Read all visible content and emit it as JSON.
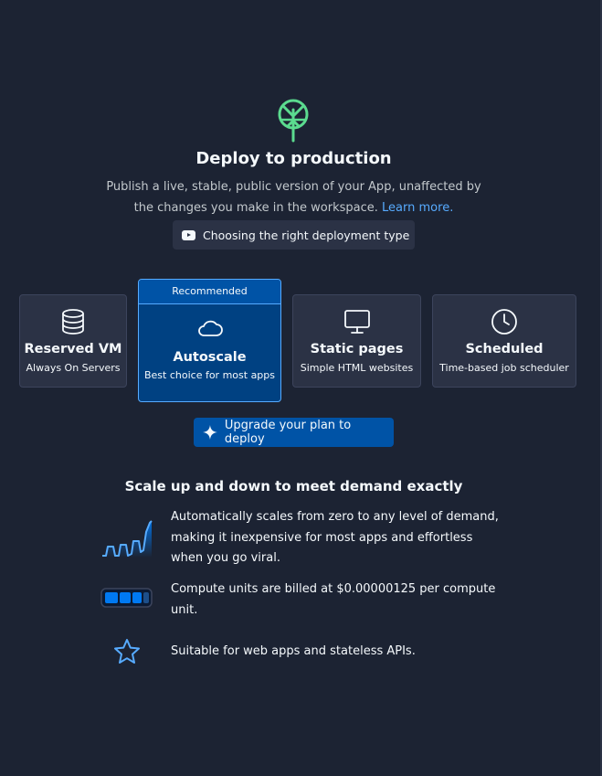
{
  "header": {
    "title": "Deploy to production",
    "subtitle": "Publish a live, stable, public version of your App, unaffected by the changes you make in the workspace.",
    "learn_more": "Learn more.",
    "video_button": "Choosing the right deployment type"
  },
  "deployment_types": [
    {
      "name": "Reserved VM",
      "description": "Always On Servers",
      "icon": "database-icon"
    },
    {
      "name": "Autoscale",
      "description": "Best choice for most apps",
      "icon": "cloud-icon",
      "badge": "Recommended",
      "selected": true
    },
    {
      "name": "Static pages",
      "description": "Simple HTML websites",
      "icon": "monitor-icon"
    },
    {
      "name": "Scheduled",
      "description": "Time-based job scheduler",
      "icon": "clock-icon"
    }
  ],
  "upgrade_button": "Upgrade your plan to deploy",
  "details": {
    "title": "Scale up and down to meet demand exactly",
    "features": [
      {
        "text": "Automatically scales from zero to any level of demand, making it inexpensive for most apps and effortless when you go viral.",
        "icon": "scaling-graph-icon"
      },
      {
        "text": "Compute units are billed at $0.00000125 per compute unit.",
        "icon": "battery-icon"
      },
      {
        "text": "Suitable for web apps and stateless APIs.",
        "icon": "star-icon"
      }
    ]
  },
  "colors": {
    "background": "#1c2333",
    "card": "#2b3245",
    "accent": "#0053a6",
    "link": "#57abff",
    "logo": "#5bdb8f"
  }
}
